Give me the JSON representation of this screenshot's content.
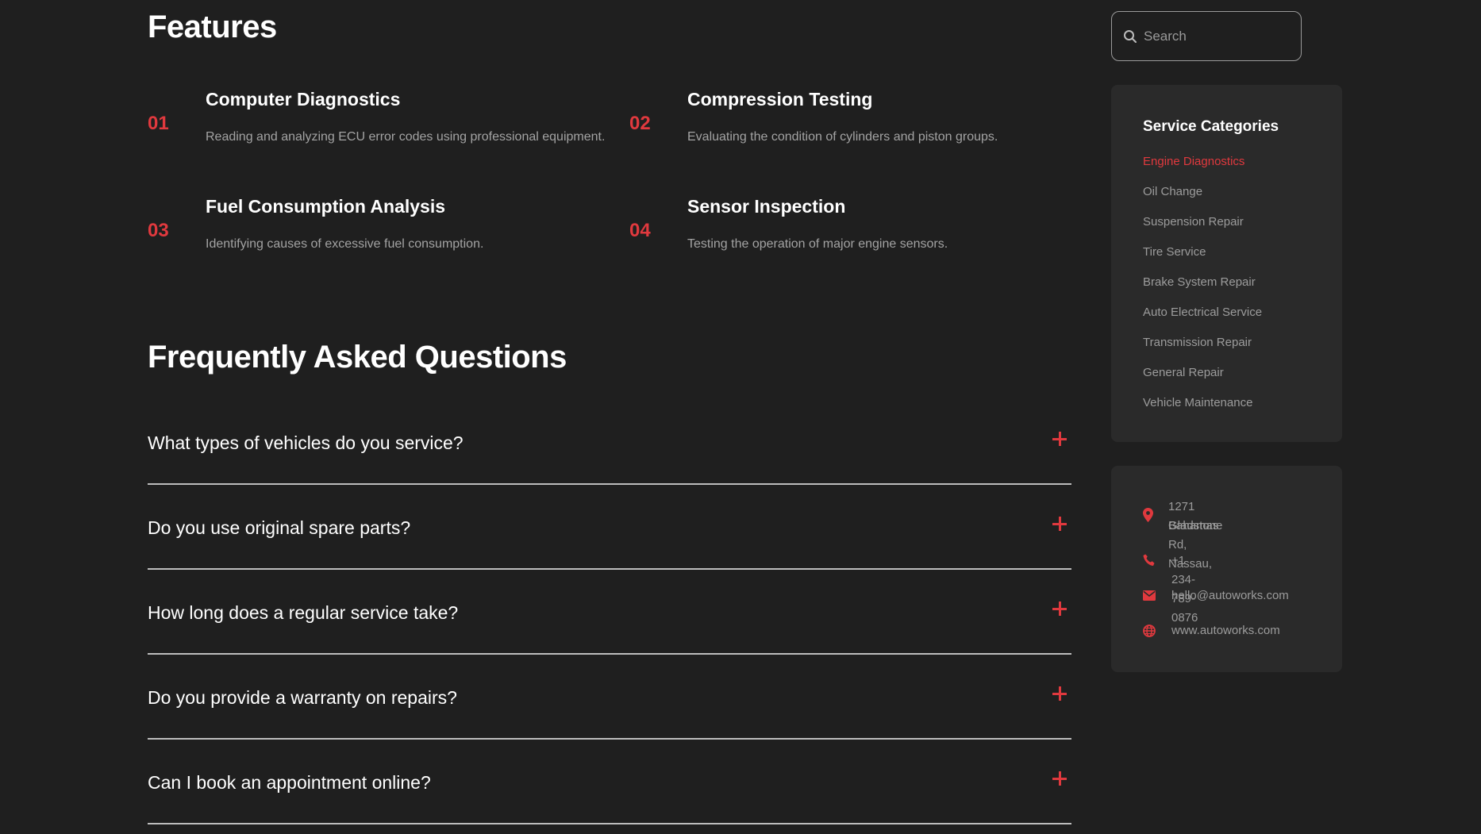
{
  "colors": {
    "background": "#1f1f1f",
    "accent": "#e0393e",
    "panel": "#2a2a2a",
    "muted": "#a3a3a3"
  },
  "features": {
    "title": "Features",
    "items": [
      {
        "number": "01",
        "title": "Computer Diagnostics",
        "description": "Reading and analyzing ECU error codes using professional equipment."
      },
      {
        "number": "02",
        "title": "Compression Testing",
        "description": "Evaluating the condition of cylinders and piston groups."
      },
      {
        "number": "03",
        "title": "Fuel Consumption Analysis",
        "description": "Identifying causes of excessive fuel consumption."
      },
      {
        "number": "04",
        "title": "Sensor Inspection",
        "description": "Testing the operation of major engine sensors."
      }
    ]
  },
  "faq": {
    "title": "Frequently Asked Questions",
    "items": [
      {
        "question": "What types of vehicles do you service?",
        "icon": "plus-icon"
      },
      {
        "question": "Do you use original spare parts?",
        "icon": "plus-icon"
      },
      {
        "question": "How long does a regular service take?",
        "icon": "plus-icon"
      },
      {
        "question": "Do you provide a warranty on repairs?",
        "icon": "plus-icon"
      },
      {
        "question": "Can I book an appointment online?",
        "icon": "plus-icon"
      }
    ]
  },
  "search": {
    "placeholder": "Search",
    "value": "",
    "icon": "search-icon"
  },
  "categories": {
    "title": "Service Categories",
    "active": "Engine Diagnostics",
    "items": [
      "Engine Diagnostics",
      "Oil Change",
      "Suspension Repair",
      "Tire Service",
      "Brake System Repair",
      "Auto Electrical Service",
      "Transmission Repair",
      "General Repair",
      "Vehicle Maintenance"
    ]
  },
  "contact": {
    "address_line1": "1271 Gladstone Rd, Nassau,",
    "address_line2": "Bahamas",
    "phone": "+1 234-789-0876",
    "email": "hello@autoworks.com",
    "website": "www.autoworks.com",
    "icons": [
      "location-pin-icon",
      "phone-icon",
      "mail-icon",
      "globe-icon"
    ]
  }
}
